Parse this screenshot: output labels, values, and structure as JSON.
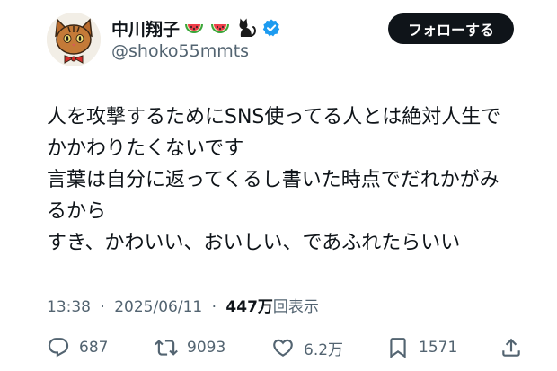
{
  "author": {
    "display_name": "中川翔子",
    "handle": "@shoko55mmts",
    "name_emojis": [
      "watermelon-emoji",
      "watermelon-emoji",
      "black-cat-emoji"
    ],
    "verified": true
  },
  "follow_button": {
    "label": "フォローする"
  },
  "body": {
    "lines": [
      "人を攻撃するためにSNS使ってる人とは絶対人生で",
      "かかわりたくないです",
      "言葉は自分に返ってくるし書いた時点でだれかがみ",
      "るから",
      "すき、かわいい、おいしい、であふれたらいい"
    ]
  },
  "meta": {
    "time": "13:38",
    "separator": "·",
    "date": "2025/06/11",
    "views_count": "447万",
    "views_label": "回表示"
  },
  "actions": {
    "replies": "687",
    "reposts": "9093",
    "likes": "6.2万",
    "bookmarks": "1571"
  },
  "colors": {
    "text": "#0f1419",
    "secondary": "#536471",
    "verified": "#1d9bf0",
    "follow_bg": "#0f1419",
    "follow_text": "#ffffff"
  }
}
